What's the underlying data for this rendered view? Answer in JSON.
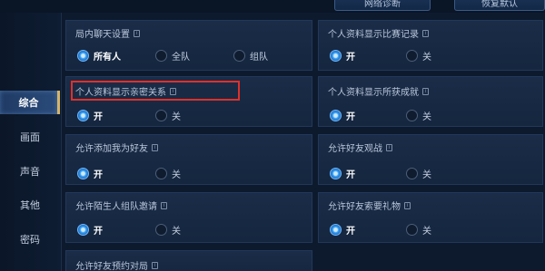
{
  "top_buttons": {
    "network": "网络诊断",
    "restore": "恢复默认"
  },
  "sidebar": {
    "items": [
      {
        "label": "综合",
        "active": true
      },
      {
        "label": "画面",
        "active": false
      },
      {
        "label": "声音",
        "active": false
      },
      {
        "label": "其他",
        "active": false
      },
      {
        "label": "密码",
        "active": false
      }
    ]
  },
  "settings": {
    "chat": {
      "title": "局内聊天设置",
      "options": [
        "所有人",
        "全队",
        "组队"
      ],
      "selected": "所有人"
    },
    "match_record": {
      "title": "个人资料显示比赛记录",
      "on": "开",
      "off": "关",
      "selected": "开"
    },
    "intimacy": {
      "title": "个人资料显示亲密关系",
      "on": "开",
      "off": "关",
      "selected": "开"
    },
    "achievements": {
      "title": "个人资料显示所获成就",
      "on": "开",
      "off": "关",
      "selected": "开"
    },
    "add_friend": {
      "title": "允许添加我为好友",
      "on": "开",
      "off": "关",
      "selected": "开"
    },
    "spectate": {
      "title": "允许好友观战",
      "on": "开",
      "off": "关",
      "selected": "开"
    },
    "stranger_invite": {
      "title": "允许陌生人组队邀请",
      "on": "开",
      "off": "关",
      "selected": "开"
    },
    "gift_request": {
      "title": "允许好友索要礼物",
      "on": "开",
      "off": "关",
      "selected": "开"
    },
    "reservation": {
      "title": "允许好友预约对局"
    }
  },
  "colors": {
    "highlight": "#e0302a",
    "accent": "#d7b46a",
    "radio_on": "#3aa6ff"
  }
}
